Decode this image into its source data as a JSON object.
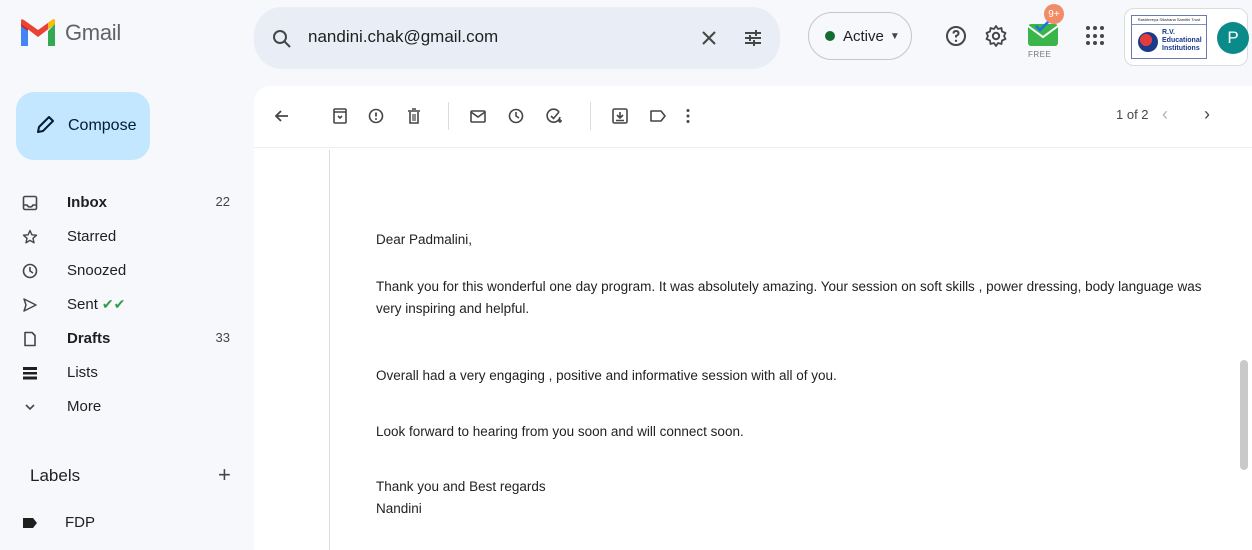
{
  "app": {
    "name": "Gmail"
  },
  "search": {
    "query": "nandini.chak@gmail.com"
  },
  "status": {
    "label": "Active"
  },
  "extension": {
    "badge": "9+",
    "tag": "FREE"
  },
  "organization": {
    "strip": "Rashtreeya Sikshana Samithi Trust",
    "line1": "R.V.",
    "line2": "Educational",
    "line3": "Institutions"
  },
  "account": {
    "initial": "P"
  },
  "compose": {
    "label": "Compose"
  },
  "nav": {
    "items": [
      {
        "label": "Inbox",
        "count": "22",
        "icon": "inbox-icon"
      },
      {
        "label": "Starred",
        "count": "",
        "icon": "star-icon"
      },
      {
        "label": "Snoozed",
        "count": "",
        "icon": "clock-icon"
      },
      {
        "label": "Sent",
        "count": "",
        "icon": "send-icon"
      },
      {
        "label": "Drafts",
        "count": "33",
        "icon": "draft-icon"
      },
      {
        "label": "Lists",
        "count": "",
        "icon": "list-icon"
      },
      {
        "label": "More",
        "count": "",
        "icon": "chevron-down-icon"
      }
    ]
  },
  "labels": {
    "header": "Labels",
    "items": [
      {
        "label": "FDP"
      }
    ]
  },
  "pager": {
    "text": "1 of 2"
  },
  "email": {
    "greeting": "Dear Padmalini,",
    "para1": "Thank you for this wonderful one day program. It was absolutely amazing. Your session on soft skills , power dressing, body language was very inspiring and helpful.",
    "para2": "Overall had a very engaging , positive and informative session with all of you.",
    "para3": "Look forward to hearing from you soon and will connect soon.",
    "closing": "Thank you and Best regards",
    "signature": "Nandini"
  },
  "colors": {
    "background": "#f6f8fc",
    "compose": "#c2e7ff",
    "search": "#e9eef6",
    "active_dot": "#146c2e",
    "avatar": "#0b8a8a"
  }
}
